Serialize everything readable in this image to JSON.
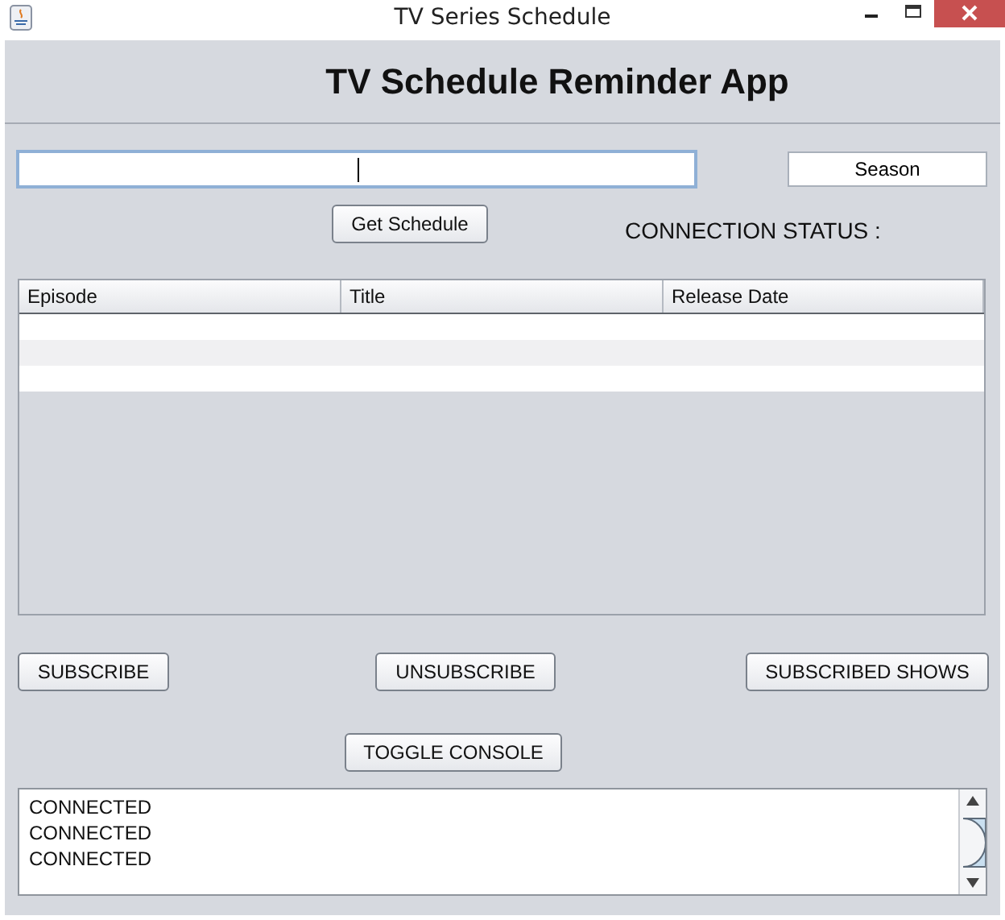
{
  "window": {
    "title": "TV Series Schedule"
  },
  "header": {
    "title": "TV Schedule Reminder App"
  },
  "series_field": {
    "focused": true
  },
  "season_field": {
    "value": "Season"
  },
  "get_schedule_button": "Get Schedule",
  "connection_status": "CONNECTION STATUS :",
  "table": {
    "columns": [
      "Episode",
      "Title",
      "Release Date"
    ]
  },
  "action_buttons": [
    "SUBSCRIBE",
    "UNSUBSCRIBE",
    "SUBSCRIBED SHOWS"
  ],
  "toggle_console_button": "TOGGLE CONSOLE",
  "console": {
    "lines": [
      "CONNECTED",
      "CONNECTED",
      "CONNECTED"
    ]
  }
}
